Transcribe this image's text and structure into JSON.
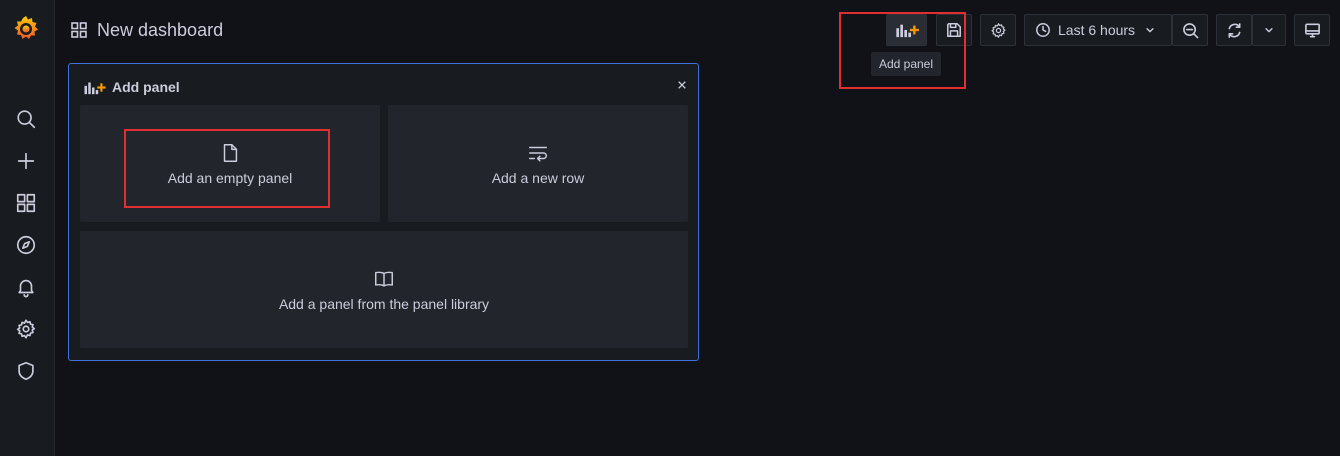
{
  "sidebar": {
    "items": [
      {
        "name": "search-icon",
        "icon": "search"
      },
      {
        "name": "create-icon",
        "icon": "plus"
      },
      {
        "name": "dashboards-icon",
        "icon": "grid"
      },
      {
        "name": "explore-icon",
        "icon": "compass"
      },
      {
        "name": "alerting-icon",
        "icon": "bell"
      },
      {
        "name": "configuration-icon",
        "icon": "gear"
      },
      {
        "name": "server-admin-icon",
        "icon": "shield"
      }
    ]
  },
  "header": {
    "title": "New dashboard",
    "time_range": "Last 6 hours",
    "tooltip": "Add panel"
  },
  "add_panel": {
    "title": "Add panel",
    "options": {
      "empty": "Add an empty panel",
      "row": "Add a new row",
      "library": "Add a panel from the panel library"
    }
  },
  "colors": {
    "accent_border": "#3d71d9",
    "highlight": "#e02f2f",
    "plus_orange": "#ff9900"
  }
}
